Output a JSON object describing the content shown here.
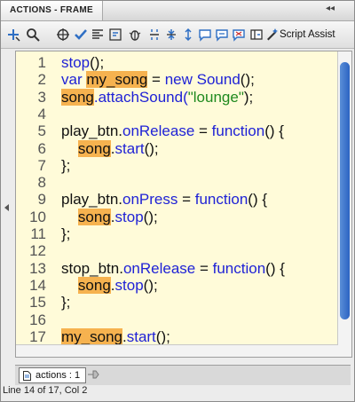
{
  "panel": {
    "tab_title": "ACTIONS - FRAME",
    "menu_glyph": "▾≡",
    "close_glyph": "◂◂"
  },
  "toolbar": {
    "icons": [
      "add-new-item-icon",
      "find-icon",
      "insert-target-path-icon",
      "check-syntax-icon",
      "auto-format-icon",
      "show-code-hint-icon",
      "debug-options-icon",
      "collapse-between-braces-icon",
      "collapse-selection-icon",
      "expand-all-icon",
      "apply-block-comment-icon",
      "apply-line-comment-icon",
      "remove-comment-icon",
      "show-hide-toolbox-icon",
      "script-assist-icon"
    ],
    "script_assist_label": "Script Assist"
  },
  "code": {
    "lines": [
      {
        "n": "1",
        "tokens": [
          {
            "t": "stop",
            "c": "kw"
          },
          {
            "t": "();",
            "c": "pl"
          }
        ]
      },
      {
        "n": "2",
        "tokens": [
          {
            "t": "var ",
            "c": "kw"
          },
          {
            "t": "my_song",
            "c": "pl hl"
          },
          {
            "t": " = ",
            "c": "pl"
          },
          {
            "t": "new Sound",
            "c": "kw"
          },
          {
            "t": "();",
            "c": "pl"
          }
        ]
      },
      {
        "n": "3",
        "tokens": [
          {
            "t": "song",
            "c": "pl hl"
          },
          {
            "t": ".attachSound(",
            "c": "kw"
          },
          {
            "t": "\"lounge\"",
            "c": "str"
          },
          {
            "t": ");",
            "c": "pl"
          }
        ]
      },
      {
        "n": "4",
        "tokens": []
      },
      {
        "n": "5",
        "tokens": [
          {
            "t": "play_btn.",
            "c": "pl"
          },
          {
            "t": "onRelease",
            "c": "kw"
          },
          {
            "t": " = ",
            "c": "pl"
          },
          {
            "t": "function",
            "c": "kw"
          },
          {
            "t": "() {",
            "c": "pl"
          }
        ]
      },
      {
        "n": "6",
        "tokens": [
          {
            "t": "    ",
            "c": "pl"
          },
          {
            "t": "song",
            "c": "pl hl"
          },
          {
            "t": ".",
            "c": "pl"
          },
          {
            "t": "start",
            "c": "kw"
          },
          {
            "t": "();",
            "c": "pl"
          }
        ]
      },
      {
        "n": "7",
        "tokens": [
          {
            "t": "};",
            "c": "pl"
          }
        ]
      },
      {
        "n": "8",
        "tokens": []
      },
      {
        "n": "9",
        "tokens": [
          {
            "t": "play_btn.",
            "c": "pl"
          },
          {
            "t": "onPress",
            "c": "kw"
          },
          {
            "t": " = ",
            "c": "pl"
          },
          {
            "t": "function",
            "c": "kw"
          },
          {
            "t": "() {",
            "c": "pl"
          }
        ]
      },
      {
        "n": "10",
        "tokens": [
          {
            "t": "    ",
            "c": "pl"
          },
          {
            "t": "song",
            "c": "pl hl"
          },
          {
            "t": ".",
            "c": "pl"
          },
          {
            "t": "stop",
            "c": "kw"
          },
          {
            "t": "();",
            "c": "pl"
          }
        ]
      },
      {
        "n": "11",
        "tokens": [
          {
            "t": "};",
            "c": "pl"
          }
        ]
      },
      {
        "n": "12",
        "tokens": []
      },
      {
        "n": "13",
        "tokens": [
          {
            "t": "stop_btn.",
            "c": "pl"
          },
          {
            "t": "onRelease",
            "c": "kw"
          },
          {
            "t": " = ",
            "c": "pl"
          },
          {
            "t": "function",
            "c": "kw"
          },
          {
            "t": "() {",
            "c": "pl"
          }
        ]
      },
      {
        "n": "14",
        "tokens": [
          {
            "t": "    ",
            "c": "pl"
          },
          {
            "t": "song",
            "c": "pl hl"
          },
          {
            "t": ".",
            "c": "pl"
          },
          {
            "t": "stop",
            "c": "kw"
          },
          {
            "t": "();",
            "c": "pl"
          }
        ]
      },
      {
        "n": "15",
        "tokens": [
          {
            "t": "};",
            "c": "pl"
          }
        ]
      },
      {
        "n": "16",
        "tokens": []
      },
      {
        "n": "17",
        "tokens": [
          {
            "t": "my_song",
            "c": "pl hl"
          },
          {
            "t": ".",
            "c": "pl"
          },
          {
            "t": "start",
            "c": "kw"
          },
          {
            "t": "();",
            "c": "pl"
          }
        ]
      }
    ]
  },
  "bottom": {
    "tab_label": "actions : 1"
  },
  "status": {
    "text": "Line 14 of 17, Col 2"
  },
  "colors": {
    "editor_bg": "#fffbd9",
    "keyword": "#1f22d6",
    "string": "#1f8a1f",
    "highlight": "#f6b24f",
    "scroll_thumb": "#2c63c2"
  }
}
